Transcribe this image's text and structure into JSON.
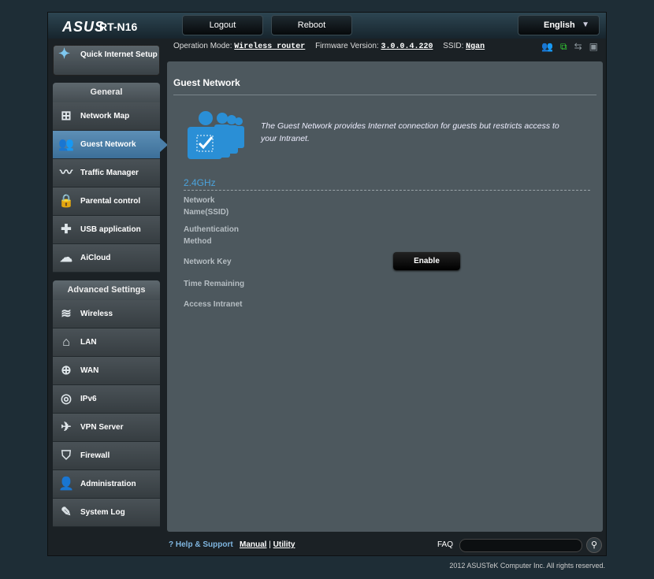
{
  "header": {
    "brand": "ASUS",
    "model": "RT-N16",
    "logout": "Logout",
    "reboot": "Reboot",
    "language": "English"
  },
  "status": {
    "op_mode_label": "Operation Mode:",
    "op_mode": "Wireless router",
    "fw_label": "Firmware Version:",
    "fw": "3.0.0.4.220",
    "ssid_label": "SSID:",
    "ssid": "Ngan"
  },
  "sidebar": {
    "qis": "Quick Internet Setup",
    "general": "General",
    "general_items": [
      {
        "label": "Network Map"
      },
      {
        "label": "Guest Network"
      },
      {
        "label": "Traffic Manager"
      },
      {
        "label": "Parental control"
      },
      {
        "label": "USB application"
      },
      {
        "label": "AiCloud"
      }
    ],
    "advanced": "Advanced Settings",
    "advanced_items": [
      {
        "label": "Wireless"
      },
      {
        "label": "LAN"
      },
      {
        "label": "WAN"
      },
      {
        "label": "IPv6"
      },
      {
        "label": "VPN Server"
      },
      {
        "label": "Firewall"
      },
      {
        "label": "Administration"
      },
      {
        "label": "System Log"
      }
    ]
  },
  "main": {
    "title": "Guest Network",
    "description": "The Guest Network provides Internet connection for guests but restricts access to your Intranet.",
    "band": "2.4GHz",
    "labels": [
      "Network Name(SSID)",
      "Authentication Method",
      "Network Key",
      "Time Remaining",
      "Access Intranet"
    ],
    "enable": "Enable"
  },
  "footer": {
    "help": "Help & Support",
    "manual": "Manual",
    "sep": "|",
    "utility": "Utility",
    "faq": "FAQ",
    "copyright": "2012 ASUSTeK Computer Inc. All rights reserved."
  },
  "colors": {
    "accent": "#4ba3dc",
    "active": "#4a7ea8"
  }
}
